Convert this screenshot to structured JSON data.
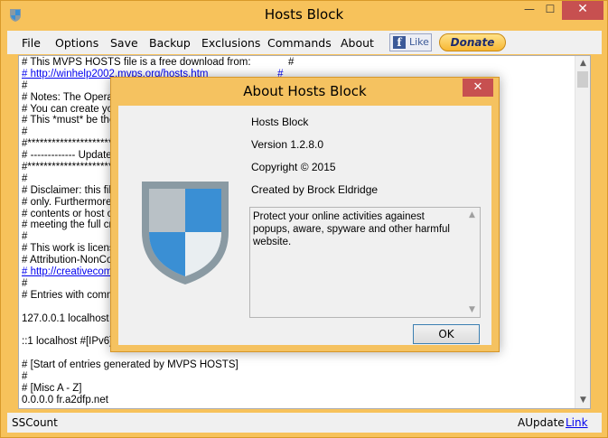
{
  "window": {
    "title": "Hosts Block",
    "minimize": "—",
    "maximize": "☐",
    "close": "✕"
  },
  "menu": {
    "items": [
      "File",
      "Options",
      "Save",
      "Backup",
      "Exclusions",
      "Commands",
      "About"
    ],
    "like": "Like",
    "fb_glyph": "f",
    "donate": "Donate"
  },
  "hosts": {
    "lines": [
      "# This MVPS HOSTS file is a free download from:             #",
      "# http://winhelp2002.mvps.org/hosts.htm                        #",
      "#",
      "# Notes: The Operat",
      "# You can create yo",
      "# This *must* be the",
      "#",
      "#**************************",
      "# ------------- Updated",
      "#**************************",
      "#",
      "# Disclaimer: this file",
      "# only. Furthermore it",
      "# contents or host or",
      "# meeting the full crit",
      "#",
      "# This work is license",
      "# Attribution-NonCom",
      "# http://creativecom",
      "#",
      "# Entries with comme",
      "",
      "127.0.0.1 localhost",
      "",
      "::1 localhost #[IPv6]",
      "",
      "# [Start of entries generated by MVPS HOSTS]",
      "#",
      "# [Misc A - Z]",
      "0.0.0.0 fr.a2dfp.net"
    ]
  },
  "status": {
    "left": "SSCount",
    "right": "AUpdate",
    "link": "Link"
  },
  "about": {
    "title": "About Hosts Block",
    "close": "✕",
    "product": "Hosts Block",
    "version": "Version 1.2.8.0",
    "copyright": "Copyright © 2015",
    "author": "Created by Brock Eldridge",
    "description": "Protect your online activities againest popups, aware, spyware and other harmful website.",
    "ok": "OK"
  },
  "icons": {
    "app": "shield-icon",
    "logo": "shield-logo-icon"
  },
  "colors": {
    "frame": "#f7c25b",
    "close": "#c75050",
    "link": "#0000ee",
    "shield_blue": "#3a8fd4",
    "shield_gray": "#8a9aa3"
  }
}
